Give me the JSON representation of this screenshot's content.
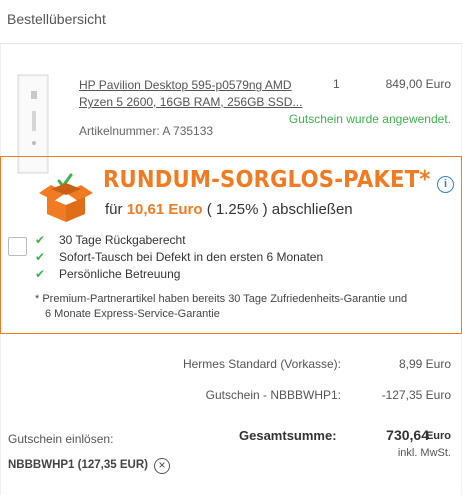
{
  "header": {
    "title": "Bestellübersicht"
  },
  "product": {
    "name_line1": "HP Pavilion Desktop 595-p0579ng AMD",
    "name_line2": "Ryzen 5 2600, 16GB RAM, 256GB SSD...",
    "quantity": "1",
    "price": "849,00 Euro",
    "voucher_status": "Gutschein wurde angewendet.",
    "article_number": "Artikelnummer: A 735133",
    "status_color": "#3db34a"
  },
  "package": {
    "title": "RUNDUM-SORGLOS-PAKET*",
    "sub_prefix": "für",
    "sub_price": "10,61 Euro",
    "sub_percent": "( 1.25% )",
    "sub_suffix": "abschließen",
    "info_icon": "info-icon",
    "benefits": [
      "30 Tage Rückgaberecht",
      "Sofort-Tausch bei Defekt in den ersten 6 Monaten",
      "Persönliche Betreuung"
    ],
    "note_line1": "* Premium-Partnerartikel haben bereits 30 Tage Zufriedenheits-Garantie und",
    "note_line2": "6 Monate Express-Service-Garantie",
    "accent_color": "#f07b22",
    "selected": false
  },
  "summary": {
    "shipping_label": "Hermes Standard (Vorkasse):",
    "shipping_value": "8,99 Euro",
    "discount_label": "Gutschein - NBBBWHP1:",
    "discount_value": "-127,35 Euro",
    "total_label": "Gesamtsumme:",
    "total_value": "730,64",
    "total_currency": "Euro",
    "total_tax": "inkl. MwSt."
  },
  "voucher": {
    "label": "Gutschein einlösen:",
    "code": "NBBBWHP1 (127,35 EUR)",
    "remove_icon": "close-circle-icon"
  }
}
